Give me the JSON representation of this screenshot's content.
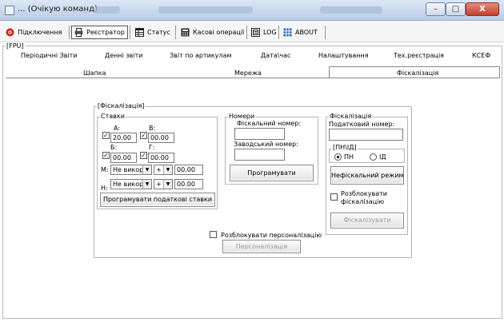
{
  "window": {
    "title": "... (Очікую команд)",
    "controls": {
      "minimize": "–",
      "maximize": "□",
      "close": "X"
    }
  },
  "toolbar": {
    "items": [
      {
        "label": "Підключення",
        "icon": "power-icon"
      },
      {
        "label": "Реєстратор",
        "icon": "printer-icon",
        "active": true
      },
      {
        "label": "Статус",
        "icon": "table-icon"
      },
      {
        "label": "Касові операції",
        "icon": "calculator-icon"
      },
      {
        "label": "LOG",
        "icon": "log-icon"
      },
      {
        "label": "ABOUT",
        "icon": "grid-icon"
      }
    ]
  },
  "fpu": {
    "group_label": "[FPU]",
    "tabs_top": [
      "Періодичні Звіти",
      "Денні звіти",
      "Звіт по артикулам",
      "Дата\\час",
      "Налаштування",
      "Тех.реєстрація",
      "КСЕФ"
    ],
    "tabs_sub": [
      "Шапка",
      "Мережа",
      "Фіскалізація"
    ],
    "active_sub_tab": "Фіскалізація"
  },
  "fiscal_panel": {
    "group_label": "[Фіскалізація]",
    "rates": {
      "group_label": "Ставки",
      "a_label": "A:",
      "a_value": "20.00",
      "b_label": "B:",
      "b_value": "00.00",
      "v_label": "Б:",
      "v_value": "00.00",
      "g_label": "Г:",
      "g_value": "00.00",
      "m_label": "M:",
      "m_select": "Не викор",
      "m_sign": "+",
      "m_value": "00.00",
      "h_label": "H:",
      "h_select": "Не викор",
      "h_sign": "+",
      "h_value": "00.00",
      "program_button": "Програмувати податкові ставки"
    },
    "numbers": {
      "group_label": "Номери",
      "fiscal_number_label": "Фіскальний номер:",
      "fiscal_number_value": "",
      "factory_number_label": "Заводський номер:",
      "factory_number_value": "",
      "program_button": "Програмувати"
    },
    "fiscalization": {
      "group_label": "Фіскалізація",
      "tax_number_label": "Податковий номер:",
      "tax_number_value": "",
      "pn_group_label": "[ПН\\ІД]",
      "radio_pn": "ПН",
      "radio_id": "ІД",
      "selected": "ПН",
      "fiscal_mode_button": "Нефіскальний режим",
      "unlock_label": "Розблокувати фіскалізацію",
      "unlock_label_line1": "Розблокувати",
      "unlock_label_line2": "фіскалізацію",
      "fiscalize_button": "Фіскалізувати"
    },
    "personalization": {
      "unlock_label": "Розблокувати персоналізацію",
      "button": "Персоналізація"
    }
  }
}
